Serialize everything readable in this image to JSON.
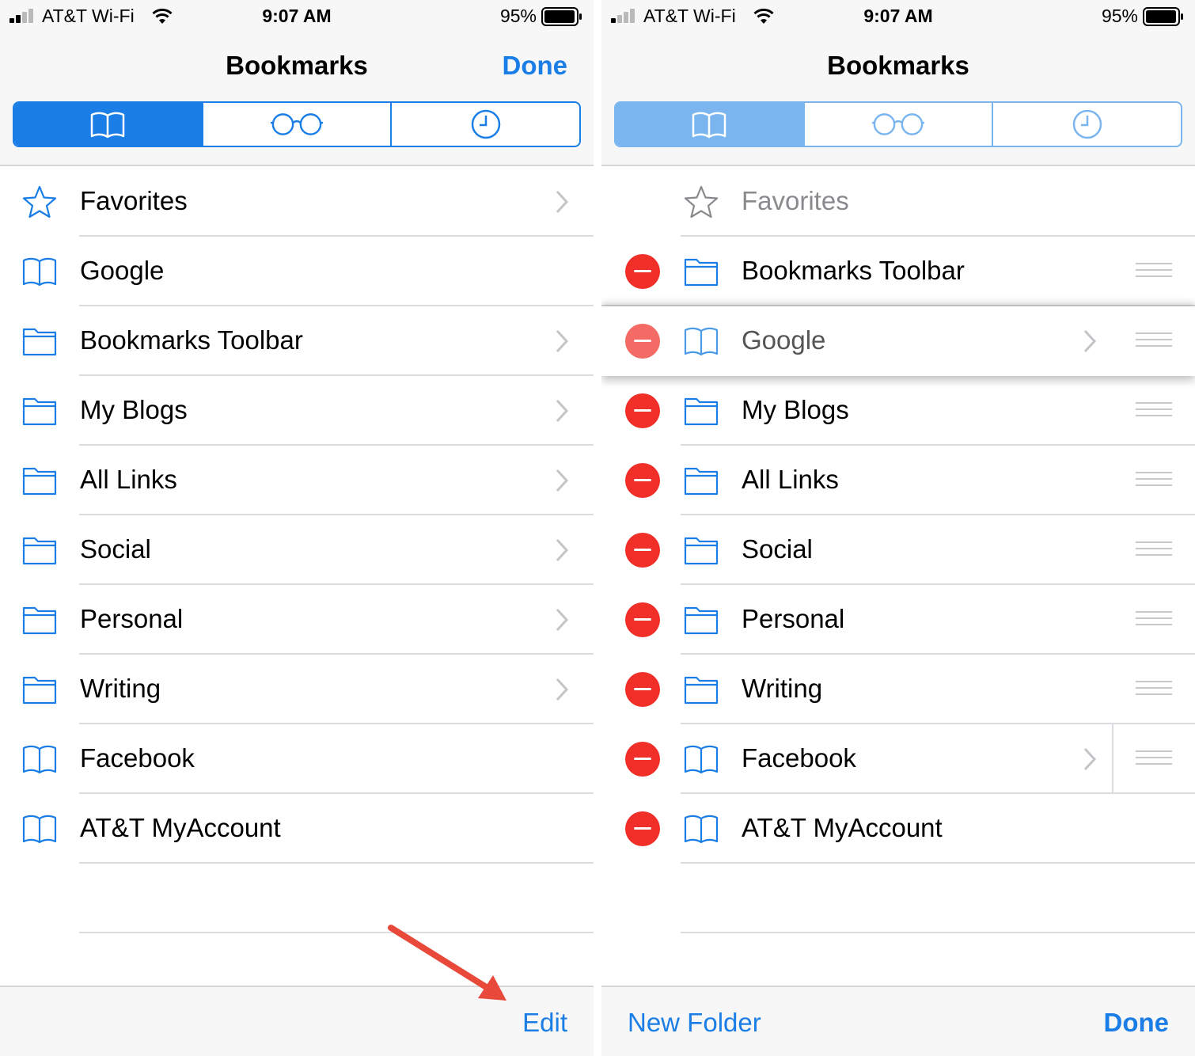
{
  "colors": {
    "accent": "#1a7ee6",
    "accent_dim": "#7ab5ef",
    "delete_red": "#f03028",
    "annotation_arrow": "#e8493a"
  },
  "left": {
    "status": {
      "carrier": "AT&T Wi-Fi",
      "time": "9:07 AM",
      "battery": "95%"
    },
    "nav": {
      "title": "Bookmarks",
      "done": "Done"
    },
    "segments": [
      {
        "icon": "book-icon",
        "selected": true
      },
      {
        "icon": "reading-list-glasses-icon",
        "selected": false
      },
      {
        "icon": "history-clock-icon",
        "selected": false
      }
    ],
    "items": [
      {
        "label": "Favorites",
        "icon": "star-icon",
        "chevron": true
      },
      {
        "label": "Google",
        "icon": "book-icon",
        "chevron": false
      },
      {
        "label": "Bookmarks Toolbar",
        "icon": "folder-icon",
        "chevron": true
      },
      {
        "label": "My Blogs",
        "icon": "folder-icon",
        "chevron": true
      },
      {
        "label": "All Links",
        "icon": "folder-icon",
        "chevron": true
      },
      {
        "label": "Social",
        "icon": "folder-icon",
        "chevron": true
      },
      {
        "label": "Personal",
        "icon": "folder-icon",
        "chevron": true
      },
      {
        "label": "Writing",
        "icon": "folder-icon",
        "chevron": true
      },
      {
        "label": "Facebook",
        "icon": "book-icon",
        "chevron": false
      },
      {
        "label": "AT&T MyAccount",
        "icon": "book-icon",
        "chevron": false
      }
    ],
    "toolbar": {
      "edit": "Edit"
    }
  },
  "right": {
    "status": {
      "carrier": "AT&T Wi-Fi",
      "time": "9:07 AM",
      "battery": "95%"
    },
    "nav": {
      "title": "Bookmarks"
    },
    "items": [
      {
        "label": "Favorites",
        "icon": "star-icon"
      },
      {
        "label": "Bookmarks Toolbar",
        "icon": "folder-icon"
      },
      {
        "label": "Google",
        "icon": "book-icon"
      },
      {
        "label": "My Blogs",
        "icon": "folder-icon"
      },
      {
        "label": "All Links",
        "icon": "folder-icon"
      },
      {
        "label": "Social",
        "icon": "folder-icon"
      },
      {
        "label": "Personal",
        "icon": "folder-icon"
      },
      {
        "label": "Writing",
        "icon": "folder-icon"
      },
      {
        "label": "Facebook",
        "icon": "book-icon"
      },
      {
        "label": "AT&T MyAccount",
        "icon": "book-icon"
      }
    ],
    "toolbar": {
      "new_folder": "New Folder",
      "done": "Done"
    }
  }
}
